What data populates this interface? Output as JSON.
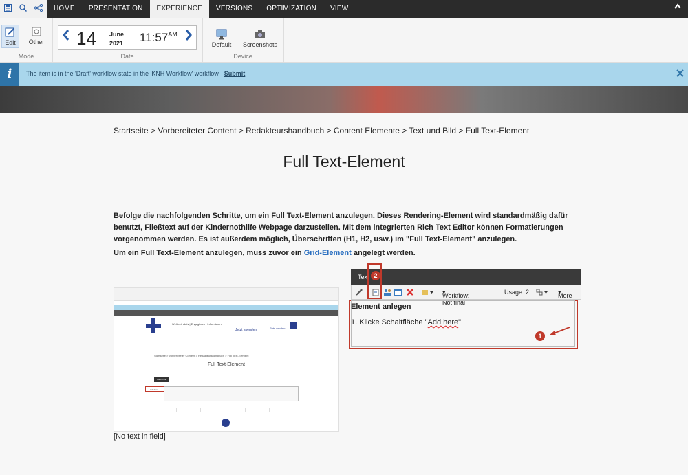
{
  "tabs": [
    "HOME",
    "PRESENTATION",
    "EXPERIENCE",
    "VERSIONS",
    "OPTIMIZATION",
    "VIEW"
  ],
  "active_tab": "EXPERIENCE",
  "ribbon": {
    "mode": {
      "label": "Mode",
      "edit": "Edit",
      "other": "Other"
    },
    "date": {
      "label": "Date",
      "day": "14",
      "month": "June",
      "year": "2021",
      "time": "11:57",
      "ampm": "AM"
    },
    "device": {
      "label": "Device",
      "default": "Default",
      "screenshots": "Screenshots"
    }
  },
  "notification": {
    "message": "The item is in the 'Draft' workflow state in the 'KNH Workflow' workflow.",
    "action": "Submit"
  },
  "breadcrumb": "Startseite > Vorbereiteter Content > Redakteurshandbuch > Content Elemente > Text und Bild > Full Text-Element",
  "page_title": "Full Text-Element",
  "intro_text": "Befolge die nachfolgenden Schritte, um ein Full Text-Element anzulegen. Dieses Rendering-Element wird standardmäßig dafür benutzt, Fließtext auf der Kindernothilfe Webpage darzustellen. Mit dem integrierten Rich Text Editor können Formatierungen vorgenommen werden. Es ist außerdem möglich, Überschriften (H1, H2, usw.) im \"Full Text-Element\" anzulegen.",
  "grid_sentence": {
    "before": "Um ein Full Text-Element anzulegen, muss zuvor ein ",
    "link": "Grid-Element",
    "after": " angelegt werden."
  },
  "image_caption": "[No text in field]",
  "editor_panel": {
    "header": "Text",
    "workflow": "Workflow: Not final",
    "usage": "Usage: 2",
    "more": "More",
    "badge1": "1",
    "badge2": "2",
    "heading": "Element anlegen",
    "step_before": "1. Klicke Schaltfläche \"",
    "step_squiggle": "Add here",
    "step_after": "\""
  },
  "thumbnail": {
    "nav": [
      "Weltweit aktiv",
      "Engagieren",
      "Informieren"
    ],
    "spenden": "Jetzt spenden",
    "pate": "Pate werden",
    "breadcrumb": "Startseite > Vorbereiteter Content > Redakteurshandbuch > Full Text-Element",
    "title": "Full Text-Element",
    "tooltip": "Insert Link",
    "add_here": "Add here"
  },
  "colors": {
    "accent": "#2a5ea8",
    "notice_bg": "#a9d6ec",
    "annotation_red": "#c0392b",
    "link": "#2a6fc0"
  }
}
